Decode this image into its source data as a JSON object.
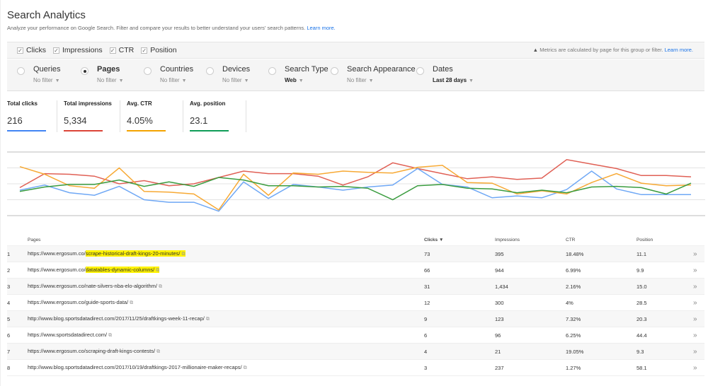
{
  "header": {
    "title": "Search Analytics",
    "subtitle": "Analyze your performance on Google Search. Filter and compare your results to better understand your users' search patterns.",
    "learn_more": "Learn more."
  },
  "metrics_bar": {
    "toggles": [
      {
        "label": "Clicks",
        "checked": true
      },
      {
        "label": "Impressions",
        "checked": true
      },
      {
        "label": "CTR",
        "checked": true
      },
      {
        "label": "Position",
        "checked": true
      }
    ],
    "notice_icon": "warning-icon",
    "notice": "Metrics are calculated by page for this group or filter.",
    "notice_link": "Learn more."
  },
  "filters": [
    {
      "label": "Queries",
      "sub": "No filter",
      "selected": false
    },
    {
      "label": "Pages",
      "sub": "No filter",
      "selected": true
    },
    {
      "label": "Countries",
      "sub": "No filter",
      "selected": false
    },
    {
      "label": "Devices",
      "sub": "No filter",
      "selected": false
    },
    {
      "label": "Search Type",
      "sub": "Web",
      "selected": false
    },
    {
      "label": "Search Appearance",
      "sub": "No filter",
      "selected": false
    },
    {
      "label": "Dates",
      "sub": "Last 28 days",
      "selected": false
    }
  ],
  "kpis": [
    {
      "label": "Total clicks",
      "value": "216",
      "color": "#4285f4"
    },
    {
      "label": "Total impressions",
      "value": "5,334",
      "color": "#db4437"
    },
    {
      "label": "Avg. CTR",
      "value": "4.05%",
      "color": "#f4a300"
    },
    {
      "label": "Avg. position",
      "value": "23.1",
      "color": "#0f9d58"
    }
  ],
  "chart_data": {
    "type": "line",
    "title": "",
    "xlabel": "",
    "ylabel": "",
    "ylim": [
      0,
      100
    ],
    "grid": true,
    "legend": "none",
    "note": "Relative index (no axis labels shown); 28 daily points",
    "x": [
      1,
      2,
      3,
      4,
      5,
      6,
      7,
      8,
      9,
      10,
      11,
      12,
      13,
      14,
      15,
      16,
      17,
      18,
      19,
      20,
      21,
      22,
      23,
      24,
      25,
      26,
      27,
      28
    ],
    "series": [
      {
        "name": "Impressions",
        "color": "#e06055",
        "values": [
          44,
          66,
          65,
          62,
          50,
          55,
          47,
          50,
          60,
          70,
          66,
          66,
          62,
          48,
          61,
          83,
          74,
          66,
          58,
          61,
          57,
          59,
          88,
          81,
          74,
          63,
          63,
          61
        ]
      },
      {
        "name": "Clicks",
        "color": "#6fa8f5",
        "values": [
          40,
          48,
          36,
          32,
          46,
          25,
          21,
          21,
          7,
          53,
          27,
          49,
          45,
          40,
          45,
          48,
          74,
          49,
          45,
          28,
          31,
          28,
          41,
          70,
          42,
          33,
          33,
          33
        ]
      },
      {
        "name": "CTR",
        "color": "#f7a934",
        "values": [
          77,
          65,
          47,
          43,
          75,
          38,
          37,
          34,
          9,
          65,
          32,
          67,
          65,
          70,
          68,
          67,
          76,
          79,
          52,
          51,
          34,
          39,
          34,
          52,
          66,
          51,
          47,
          48
        ]
      },
      {
        "name": "Position",
        "color": "#3a9c3f",
        "values": [
          38,
          45,
          49,
          49,
          56,
          46,
          53,
          46,
          60,
          56,
          47,
          47,
          45,
          46,
          43,
          25,
          47,
          49,
          43,
          42,
          36,
          40,
          36,
          45,
          46,
          44,
          34,
          51
        ]
      }
    ]
  },
  "table": {
    "headers": {
      "pages": "Pages",
      "clicks": "Clicks ▼",
      "impressions": "Impressions",
      "ctr": "CTR",
      "position": "Position"
    },
    "rows": [
      {
        "idx": "1",
        "base": "https://www.ergosum.co/",
        "path": "scrape-historical-draft-kings-20-minutes/",
        "highlight": true,
        "clicks": "73",
        "impressions": "395",
        "ctr": "18.48%",
        "position": "11.1"
      },
      {
        "idx": "2",
        "base": "https://www.ergosum.co/",
        "path": "datatables-dynamic-columns/",
        "highlight": true,
        "clicks": "66",
        "impressions": "944",
        "ctr": "6.99%",
        "position": "9.9"
      },
      {
        "idx": "3",
        "base": "https://www.ergosum.co/",
        "path": "nate-silvers-nba-elo-algorithm/",
        "highlight": false,
        "clicks": "31",
        "impressions": "1,434",
        "ctr": "2.16%",
        "position": "15.0"
      },
      {
        "idx": "4",
        "base": "https://www.ergosum.co/",
        "path": "guide-sports-data/",
        "highlight": false,
        "clicks": "12",
        "impressions": "300",
        "ctr": "4%",
        "position": "28.5"
      },
      {
        "idx": "5",
        "base": "http://www.blog.sportsdatadirect.com/",
        "path": "2017/11/25/draftkings-week-11-recap/",
        "highlight": false,
        "clicks": "9",
        "impressions": "123",
        "ctr": "7.32%",
        "position": "20.3"
      },
      {
        "idx": "6",
        "base": "https://www.sportsdatadirect.com/",
        "path": "",
        "highlight": false,
        "clicks": "6",
        "impressions": "96",
        "ctr": "6.25%",
        "position": "44.4"
      },
      {
        "idx": "7",
        "base": "https://www.ergosum.co/",
        "path": "scraping-draft-kings-contests/",
        "highlight": false,
        "clicks": "4",
        "impressions": "21",
        "ctr": "19.05%",
        "position": "9.3"
      },
      {
        "idx": "8",
        "base": "http://www.blog.sportsdatadirect.com/",
        "path": "2017/10/19/draftkings-2017-millionaire-maker-recaps/",
        "highlight": false,
        "clicks": "3",
        "impressions": "237",
        "ctr": "1.27%",
        "position": "58.1"
      }
    ],
    "ext_icon": "☐",
    "row_action_icon": "»"
  }
}
